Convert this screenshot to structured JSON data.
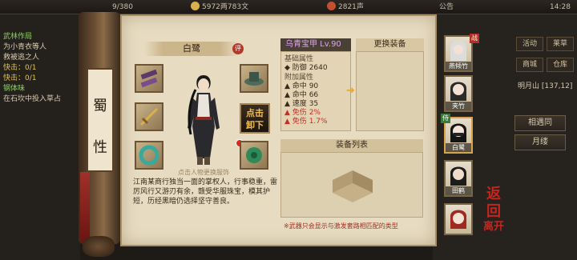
{
  "topbar": {
    "left_value": "9/380",
    "money": "5972两783文",
    "prestige": "2821声",
    "notice": "公告",
    "time": "14:28"
  },
  "quest": {
    "lines": [
      "武林作局",
      "为小青衣等人",
      "救被逃之人",
      "快击：0/1",
      "快击：0/1",
      "钢体味",
      "在石坎中投入草占"
    ]
  },
  "right_menu": {
    "buttons": [
      "活动",
      "莱草",
      "商城",
      "仓库"
    ],
    "location": "明月山",
    "location_coords": "[137,12]",
    "side_buttons": [
      "相遇同",
      "月缕"
    ]
  },
  "scroll": {
    "rod_chars": [
      "蜀",
      "性"
    ]
  },
  "character": {
    "name": "白鹭",
    "eval_badge": "评",
    "unequip_line1": "点击",
    "unequip_line2": "卸下",
    "hint": "点击人物更换服饰",
    "description": "江南某商行独当一面的掌权人，行事稳重，雷厉风行又游刃有余，赣受华服珠宝，模其护短，历经黑暗仍选择坚守善良。"
  },
  "equipment_stats": {
    "title": "乌青宝甲 Lv.90",
    "base_label": "基础属性",
    "base_rows": [
      {
        "name": "防御",
        "value": "2640"
      }
    ],
    "extra_label": "附加属性",
    "extra_rows": [
      {
        "name": "命中",
        "value": "90",
        "red": false
      },
      {
        "name": "命中",
        "value": "66",
        "red": false
      },
      {
        "name": "速度",
        "value": "35",
        "red": false
      },
      {
        "name": "免伤",
        "value": "2%",
        "red": true
      },
      {
        "name": "免伤",
        "value": "1.7%",
        "red": true
      }
    ]
  },
  "swap": {
    "title": "更换装备"
  },
  "equip_list": {
    "title": "装备列表",
    "note": "※武器只会显示与激发套路相匹配的类型"
  },
  "portraits": [
    {
      "name": "燕倾竹",
      "tag": "战"
    },
    {
      "name": "夹竹",
      "tag": ""
    },
    {
      "name": "白鹭",
      "tag": "侍"
    },
    {
      "name": "田鹤",
      "tag": ""
    },
    {
      "name": "",
      "tag": ""
    }
  ],
  "return_button": {
    "line1": "返",
    "line2": "回",
    "line3": "离开"
  },
  "colors": {
    "accent_red": "#c23024",
    "gold": "#e6a820",
    "parchment": "#e7dcc2"
  }
}
